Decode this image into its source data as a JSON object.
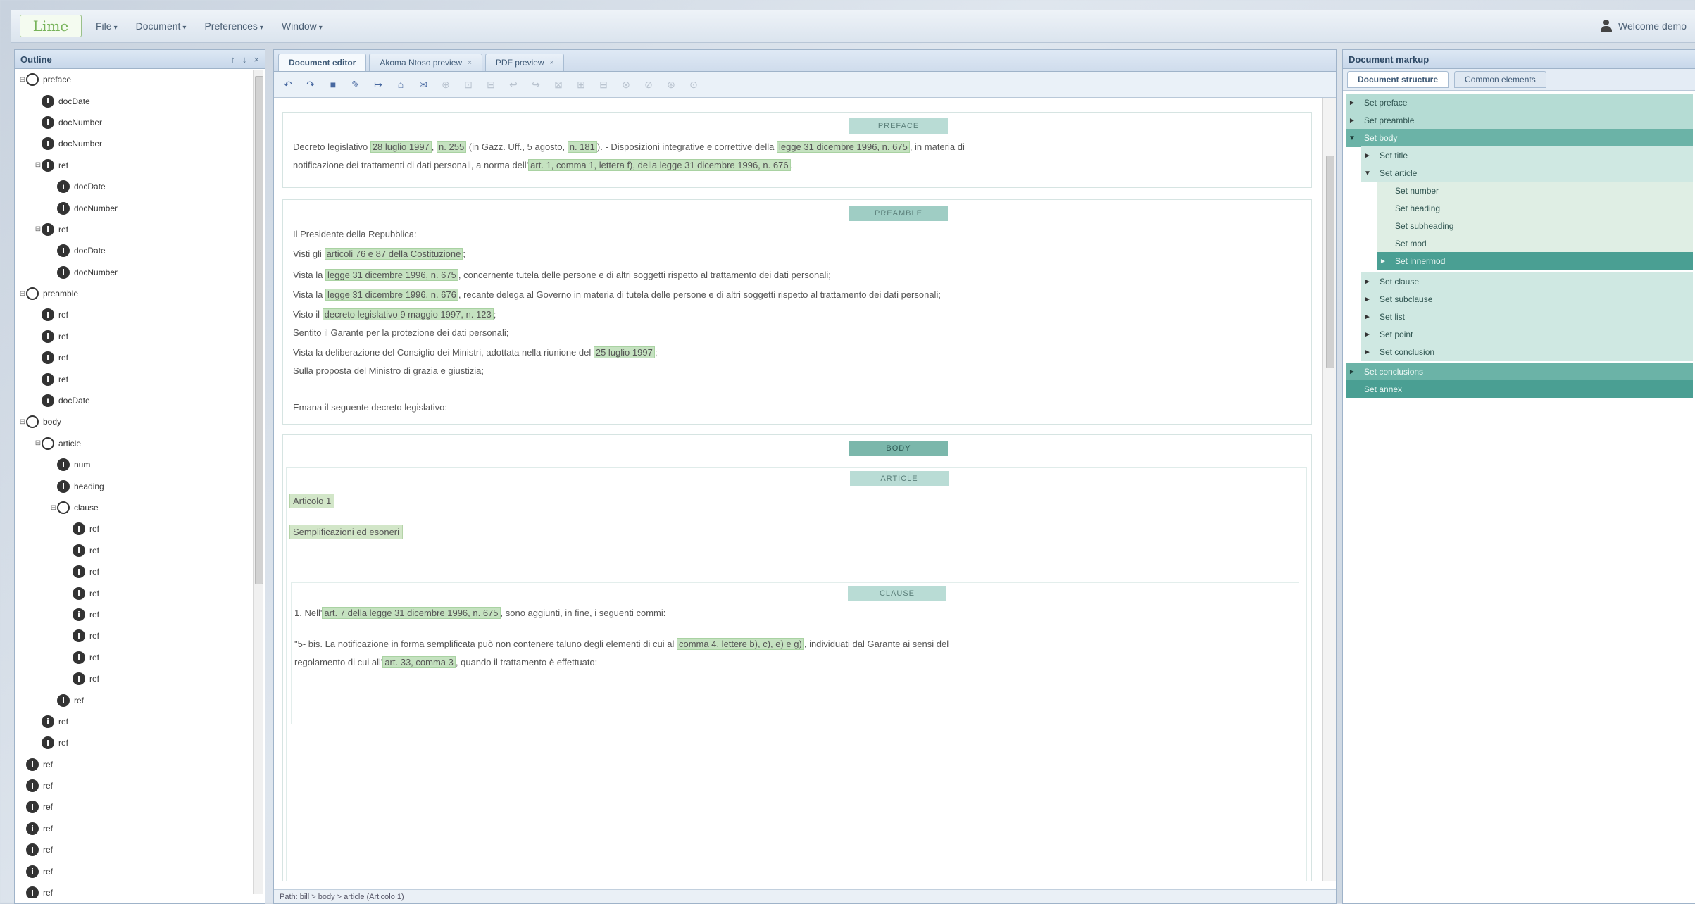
{
  "app": {
    "logo": "Lime",
    "menu": [
      {
        "label": "File"
      },
      {
        "label": "Document"
      },
      {
        "label": "Preferences"
      },
      {
        "label": "Window"
      }
    ],
    "welcome": "Welcome demo"
  },
  "outline": {
    "title": "Outline",
    "tools": [
      "↑",
      "↓",
      "×"
    ],
    "rows": [
      {
        "exp": "⊟",
        "icon": "folder",
        "label": "preface",
        "indent": 0
      },
      {
        "exp": "",
        "icon": "info",
        "label": "docDate",
        "indent": 1
      },
      {
        "exp": "",
        "icon": "info",
        "label": "docNumber",
        "indent": 1
      },
      {
        "exp": "",
        "icon": "info",
        "label": "docNumber",
        "indent": 1
      },
      {
        "exp": "⊟",
        "icon": "info",
        "label": "ref",
        "indent": 1
      },
      {
        "exp": "",
        "icon": "info",
        "label": "docDate",
        "indent": 2
      },
      {
        "exp": "",
        "icon": "info",
        "label": "docNumber",
        "indent": 2
      },
      {
        "exp": "⊟",
        "icon": "info",
        "label": "ref",
        "indent": 1
      },
      {
        "exp": "",
        "icon": "info",
        "label": "docDate",
        "indent": 2
      },
      {
        "exp": "",
        "icon": "info",
        "label": "docNumber",
        "indent": 2
      },
      {
        "exp": "⊟",
        "icon": "folder",
        "label": "preamble",
        "indent": 0
      },
      {
        "exp": "",
        "icon": "info",
        "label": "ref",
        "indent": 1
      },
      {
        "exp": "",
        "icon": "info",
        "label": "ref",
        "indent": 1
      },
      {
        "exp": "",
        "icon": "info",
        "label": "ref",
        "indent": 1
      },
      {
        "exp": "",
        "icon": "info",
        "label": "ref",
        "indent": 1
      },
      {
        "exp": "",
        "icon": "info",
        "label": "docDate",
        "indent": 1
      },
      {
        "exp": "⊟",
        "icon": "folder",
        "label": "body",
        "indent": 0
      },
      {
        "exp": "⊟",
        "icon": "folder",
        "label": "article",
        "indent": 1
      },
      {
        "exp": "",
        "icon": "info",
        "label": "num",
        "indent": 2
      },
      {
        "exp": "",
        "icon": "info",
        "label": "heading",
        "indent": 2
      },
      {
        "exp": "⊟",
        "icon": "folder",
        "label": "clause",
        "indent": 2
      },
      {
        "exp": "",
        "icon": "info",
        "label": "ref",
        "indent": 3
      },
      {
        "exp": "",
        "icon": "info",
        "label": "ref",
        "indent": 3
      },
      {
        "exp": "",
        "icon": "info",
        "label": "ref",
        "indent": 3
      },
      {
        "exp": "",
        "icon": "info",
        "label": "ref",
        "indent": 3
      },
      {
        "exp": "",
        "icon": "info",
        "label": "ref",
        "indent": 3
      },
      {
        "exp": "",
        "icon": "info",
        "label": "ref",
        "indent": 3
      },
      {
        "exp": "",
        "icon": "info",
        "label": "ref",
        "indent": 3
      },
      {
        "exp": "",
        "icon": "info",
        "label": "ref",
        "indent": 3
      },
      {
        "exp": "",
        "icon": "info",
        "label": "ref",
        "indent": 2
      },
      {
        "exp": "",
        "icon": "info",
        "label": "ref",
        "indent": 1
      },
      {
        "exp": "",
        "icon": "info",
        "label": "ref",
        "indent": 1
      },
      {
        "exp": "",
        "icon": "info",
        "label": "ref",
        "indent": 0
      },
      {
        "exp": "",
        "icon": "info",
        "label": "ref",
        "indent": 0
      },
      {
        "exp": "",
        "icon": "info",
        "label": "ref",
        "indent": 0
      },
      {
        "exp": "",
        "icon": "info",
        "label": "ref",
        "indent": 0
      },
      {
        "exp": "",
        "icon": "info",
        "label": "ref",
        "indent": 0
      },
      {
        "exp": "",
        "icon": "info",
        "label": "ref",
        "indent": 0
      },
      {
        "exp": "",
        "icon": "info",
        "label": "ref",
        "indent": 0
      }
    ]
  },
  "editor": {
    "tabs": [
      {
        "label": "Document editor",
        "closable": false
      },
      {
        "label": "Akoma Ntoso preview",
        "closable": true
      },
      {
        "label": "PDF preview",
        "closable": true
      }
    ],
    "toolbar_icons": [
      "↶",
      "↷",
      "■",
      "✎",
      "↦",
      "⌂",
      "✉",
      "⊕",
      "⊡",
      "⊟",
      "↩",
      "↪",
      "⊠",
      "⊞",
      "⊟",
      "⊗",
      "⊘",
      "⊛",
      "⊙"
    ],
    "path": "Path: bill > body > article (Articolo 1)",
    "preface": {
      "label": "PREFACE",
      "line1": [
        {
          "t": "Decreto legislativo ",
          "h": false
        },
        {
          "t": "28 luglio 1997",
          "h": true
        },
        {
          "t": ", ",
          "h": false
        },
        {
          "t": "n. 255",
          "h": true
        },
        {
          "t": " (in Gazz. Uff., 5 agosto, ",
          "h": false
        },
        {
          "t": "n. 181",
          "h": true
        },
        {
          "t": "). - Disposizioni integrative e correttive della ",
          "h": false
        },
        {
          "t": "legge 31 dicembre 1996, n. 675",
          "h": true
        },
        {
          "t": ", in materia di",
          "h": false
        }
      ],
      "line2": [
        {
          "t": "notificazione dei trattamenti di dati personali, a norma dell'",
          "h": false
        },
        {
          "t": "art. 1, comma 1, lettera f), della legge 31 dicembre 1996, n. 676",
          "h": true
        },
        {
          "t": ".",
          "h": false
        }
      ]
    },
    "preamble": {
      "label": "PREAMBLE",
      "lines": [
        [
          {
            "t": "Il Presidente della Repubblica:",
            "h": false
          }
        ],
        [
          {
            "t": "Visti gli ",
            "h": false
          },
          {
            "t": "articoli 76 e 87 della Costituzione",
            "h": true
          },
          {
            "t": ";",
            "h": false
          }
        ],
        [
          {
            "t": "Vista la ",
            "h": false
          },
          {
            "t": "legge 31 dicembre 1996, n. 675",
            "h": true
          },
          {
            "t": ", concernente tutela delle persone e di altri soggetti rispetto al trattamento dei dati personali;",
            "h": false
          }
        ],
        [
          {
            "t": "Vista la ",
            "h": false
          },
          {
            "t": "legge 31 dicembre 1996, n. 676",
            "h": true
          },
          {
            "t": ", recante delega al Governo in materia di tutela delle persone e di altri soggetti rispetto al trattamento dei dati personali;",
            "h": false
          }
        ],
        [
          {
            "t": "Visto il ",
            "h": false
          },
          {
            "t": "decreto legislativo 9 maggio 1997, n. 123",
            "h": true
          },
          {
            "t": ";",
            "h": false
          }
        ],
        [
          {
            "t": "Sentito il Garante per la protezione dei dati personali;",
            "h": false
          }
        ],
        [
          {
            "t": "Vista la deliberazione del Consiglio dei Ministri, adottata nella riunione del ",
            "h": false
          },
          {
            "t": "25 luglio 1997",
            "h": true
          },
          {
            "t": ";",
            "h": false
          }
        ],
        [
          {
            "t": "Sulla proposta del Ministro di grazia e giustizia;",
            "h": false
          }
        ],
        [
          {
            "t": "Emana il seguente decreto legislativo:",
            "h": false
          }
        ]
      ]
    },
    "body": {
      "label": "BODY",
      "article_label": "ARTICLE",
      "num": "Articolo 1",
      "heading": "Semplificazioni ed esoneri",
      "clause_label": "CLAUSE",
      "clause_line1": [
        {
          "t": "1. Nell'",
          "h": false
        },
        {
          "t": "art. 7 della legge 31 dicembre 1996, n. 675",
          "h": true
        },
        {
          "t": ", sono aggiunti, in fine, i seguenti commi:",
          "h": false
        }
      ],
      "clause_line2": [
        {
          "t": "\"5- bis. La notificazione in forma semplificata può non contenere taluno degli elementi di cui al ",
          "h": false
        },
        {
          "t": "comma 4, lettere b), c), e) e g)",
          "h": true
        },
        {
          "t": ", individuati dal Garante ai sensi del",
          "h": false
        }
      ],
      "clause_line3": [
        {
          "t": "regolamento di cui all'",
          "h": false
        },
        {
          "t": "art. 33, comma 3",
          "h": true
        },
        {
          "t": ", quando il trattamento è effettuato:",
          "h": false
        }
      ]
    }
  },
  "markup": {
    "title": "Document markup",
    "tabs": [
      "Document structure",
      "Common elements"
    ],
    "rows": [
      {
        "label": "Set preface",
        "arrow": "►",
        "level": 0,
        "style": "l0"
      },
      {
        "label": "Set preamble",
        "arrow": "►",
        "level": 0,
        "style": "l0"
      },
      {
        "label": "Set body",
        "arrow": "▼",
        "level": 0,
        "style": "expanded"
      },
      {
        "label": "Set title",
        "arrow": "►",
        "level": 1,
        "style": "l1"
      },
      {
        "label": "Set article",
        "arrow": "▼",
        "level": 1,
        "style": "l1"
      },
      {
        "label": "Set number",
        "arrow": "",
        "level": 2,
        "style": "l2"
      },
      {
        "label": "Set heading",
        "arrow": "",
        "level": 2,
        "style": "l2"
      },
      {
        "label": "Set subheading",
        "arrow": "",
        "level": 2,
        "style": "l2"
      },
      {
        "label": "Set mod",
        "arrow": "",
        "level": 2,
        "style": "l2"
      },
      {
        "label": "Set innermod",
        "arrow": "►",
        "level": 2,
        "style": "active"
      },
      {
        "label": "Set clause",
        "arrow": "►",
        "level": 1,
        "style": "l1"
      },
      {
        "label": "Set subclause",
        "arrow": "►",
        "level": 1,
        "style": "l1"
      },
      {
        "label": "Set list",
        "arrow": "►",
        "level": 1,
        "style": "l1"
      },
      {
        "label": "Set point",
        "arrow": "►",
        "level": 1,
        "style": "l1"
      },
      {
        "label": "Set conclusion",
        "arrow": "►",
        "level": 1,
        "style": "l1"
      },
      {
        "label": "Set conclusions",
        "arrow": "►",
        "level": 0,
        "style": "expanded"
      },
      {
        "label": "Set annex",
        "arrow": "",
        "level": 0,
        "style": "active"
      }
    ]
  }
}
